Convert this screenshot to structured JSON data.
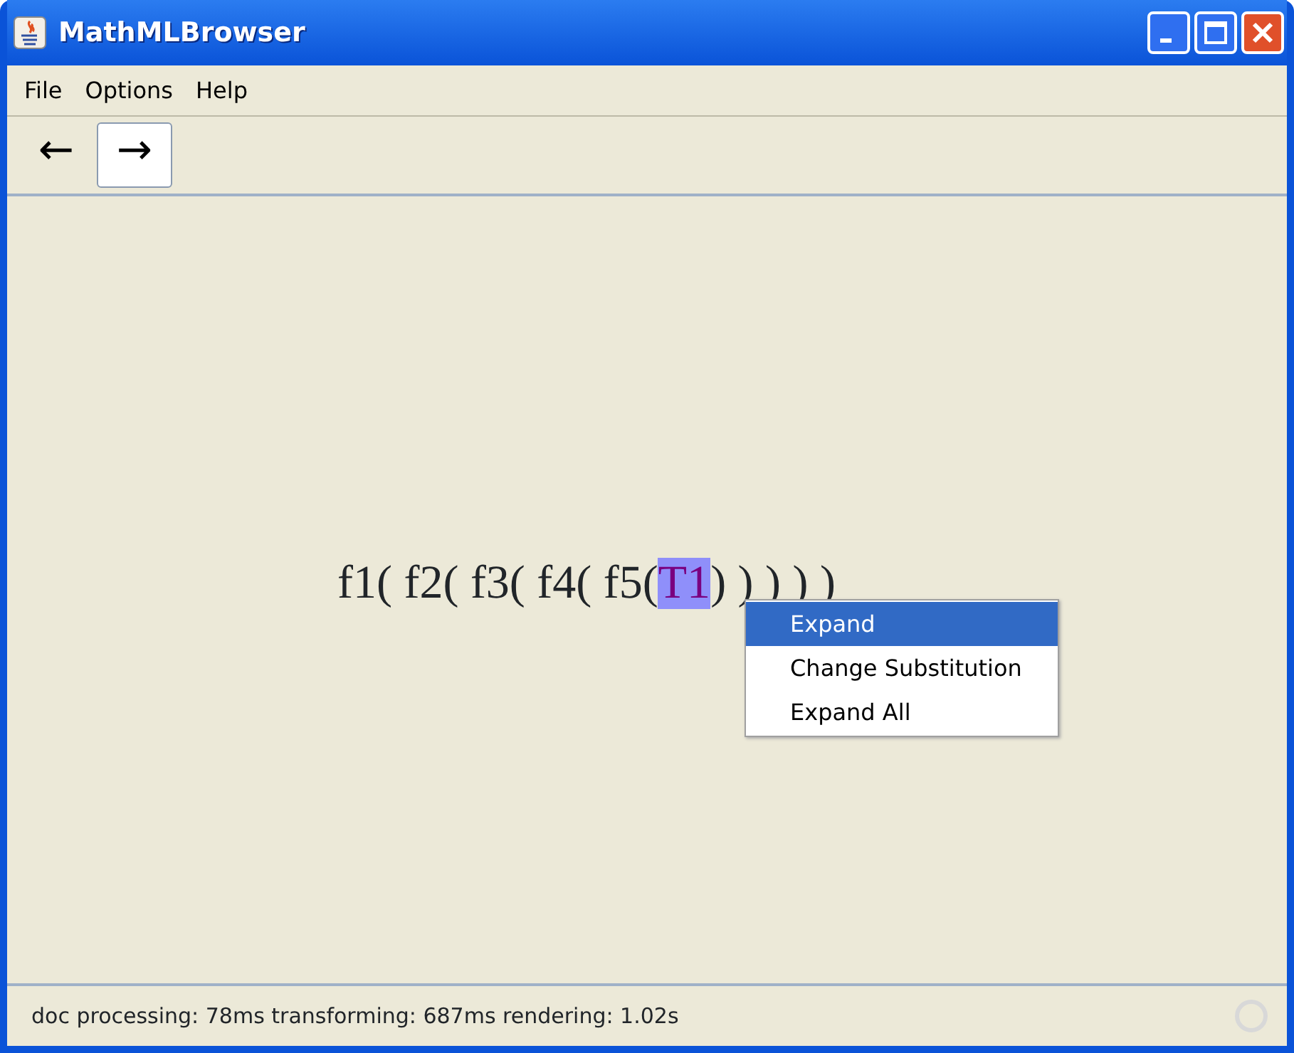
{
  "window": {
    "title": "MathMLBrowser"
  },
  "menu_bar": [
    "File",
    "Options",
    "Help"
  ],
  "toolbar": [
    {
      "label": "←",
      "selected": false
    },
    {
      "label": "→",
      "selected": true
    }
  ],
  "formula": {
    "before": "f1( f2( f3( f4( f5(",
    "term": "T1",
    "after": ") ) ) ) )"
  },
  "context_menu": [
    {
      "label": "Expand",
      "selected": true
    },
    {
      "label": "Change Substitution",
      "selected": false
    },
    {
      "label": "Expand All",
      "selected": false
    }
  ],
  "status_bar": "doc processing: 78ms transforming: 687ms rendering: 1.02s"
}
